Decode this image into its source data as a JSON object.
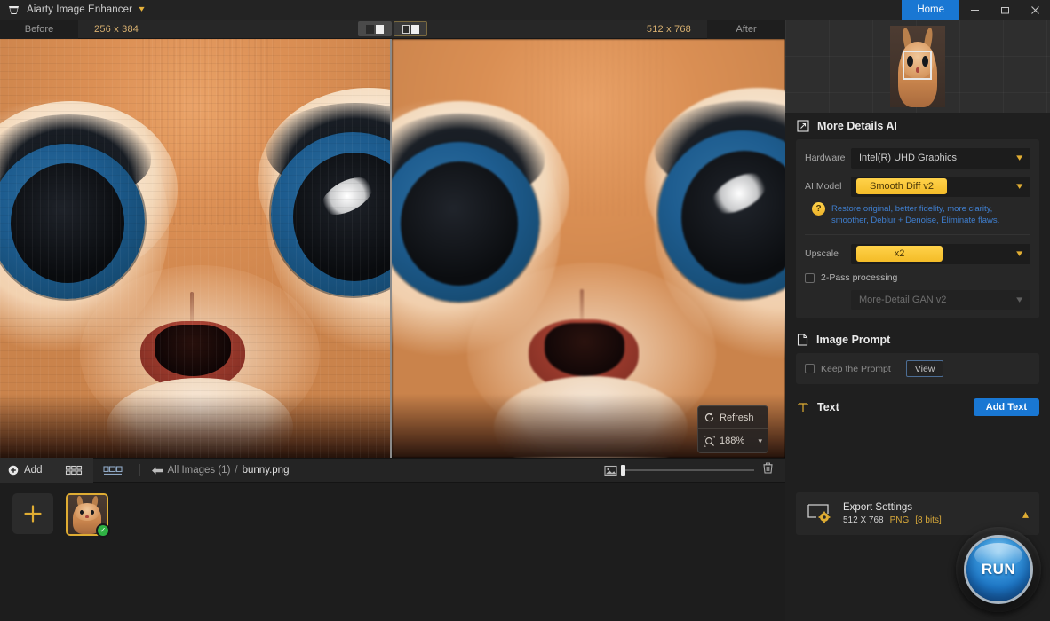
{
  "titlebar": {
    "app_title": "Aiarty Image Enhancer",
    "logo_icon": "aiarty-logo-icon",
    "caret_icon": "chevron-down-icon",
    "home_label": "Home",
    "minimize_icon": "minimize-icon",
    "maximize_icon": "maximize-icon",
    "close_icon": "close-icon"
  },
  "compare_bar": {
    "before_label": "Before",
    "before_dimensions": "256 x 384",
    "after_dimensions": "512 x 768",
    "after_label": "After",
    "view_single_icon": "single-view-icon",
    "view_split_icon": "split-view-icon"
  },
  "canvas_overlay": {
    "refresh_label": "Refresh",
    "refresh_icon": "refresh-icon",
    "zoom_icon": "zoom-icon",
    "zoom_level": "188%",
    "zoom_caret": "chevron-down-icon"
  },
  "strip_toolbar": {
    "add_label": "Add",
    "add_icon": "plus-circle-icon",
    "grid_view_icon": "grid-view-icon",
    "list_view_icon": "filmstrip-view-icon",
    "back_icon": "arrow-left-icon",
    "breadcrumb_all": "All Images (1)",
    "breadcrumb_separator": "/",
    "breadcrumb_file": "bunny.png",
    "thumb_size_icon": "image-size-icon",
    "delete_icon": "trash-icon"
  },
  "thumbnails": {
    "add_tile_icon": "plus-icon",
    "items": [
      {
        "name": "bunny.png",
        "selected": true,
        "status_icon": "check-icon"
      }
    ]
  },
  "right_panel": {
    "navigator": {
      "viewport_name": "navigator-viewport"
    },
    "more_details": {
      "section_icon": "expand-arrows-icon",
      "section_title": "More Details AI",
      "hardware_label": "Hardware",
      "hardware_value": "Intel(R) UHD Graphics",
      "ai_model_label": "AI Model",
      "ai_model_value": "Smooth Diff v2",
      "help_icon": "question-mark-icon",
      "model_description_line1": "Restore original, better fidelity, more clarity,",
      "model_description_line2": "smoother, Deblur + Denoise, Eliminate flaws.",
      "upscale_label": "Upscale",
      "upscale_value": "x2",
      "two_pass_label": "2-Pass processing",
      "two_pass_checked": false,
      "two_pass_model_value": "More-Detail GAN v2",
      "caret_icon": "chevron-down-icon"
    },
    "image_prompt": {
      "section_icon": "document-icon",
      "section_title": "Image Prompt",
      "keep_prompt_label": "Keep the Prompt",
      "keep_prompt_checked": false,
      "view_button_label": "View"
    },
    "text_section": {
      "section_icon": "text-tool-icon",
      "section_title": "Text",
      "add_text_button": "Add Text"
    },
    "export": {
      "icon": "export-settings-icon",
      "title": "Export Settings",
      "dimensions": "512 X 768",
      "format": "PNG",
      "bit_depth": "[8 bits]",
      "collapse_icon": "chevron-up-icon"
    },
    "run_button": {
      "label": "RUN"
    }
  },
  "colors": {
    "accent_gold": "#f4bc28",
    "accent_blue": "#1977d3",
    "description_blue": "#3f7fd0",
    "panel_bg": "#1f1f1f",
    "card_bg": "#272727",
    "status_green": "#2fb344"
  }
}
